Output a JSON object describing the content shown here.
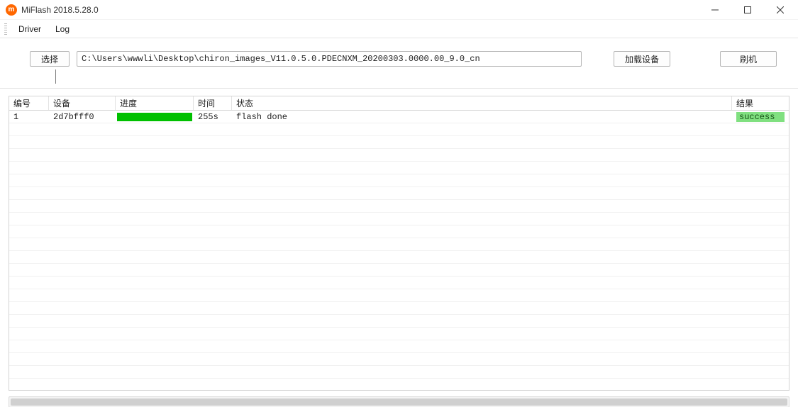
{
  "window": {
    "title": "MiFlash 2018.5.28.0",
    "icon_letter": "m"
  },
  "menu": {
    "driver": "Driver",
    "log": "Log"
  },
  "toolbar": {
    "select_label": "选择",
    "path_value": "C:\\Users\\wwwli\\Desktop\\chiron_images_V11.0.5.0.PDECNXM_20200303.0000.00_9.0_cn",
    "load_label": "加载设备",
    "flash_label": "刷机",
    "status_text": ""
  },
  "table": {
    "headers": {
      "id": "编号",
      "device": "设备",
      "progress": "进度",
      "time": "时间",
      "status": "状态",
      "result": "结果"
    },
    "rows": [
      {
        "id": "1",
        "device": "2d7bfff0",
        "progress_pct": 100,
        "time": "255s",
        "status": "flash done",
        "result": "success"
      }
    ]
  },
  "colors": {
    "progress_fill": "#00c000",
    "result_success_bg": "#80e080",
    "accent": "#ff6700"
  }
}
